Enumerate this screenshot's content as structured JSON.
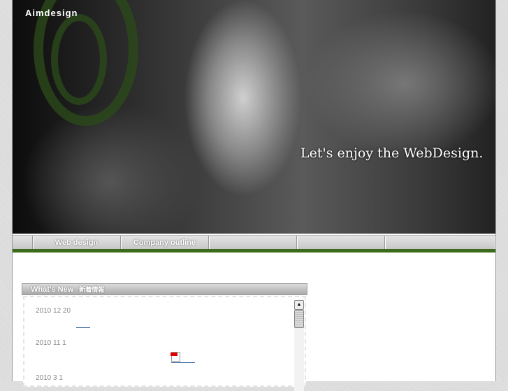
{
  "header": {
    "logo": "Aimdesign",
    "tagline": "Let's enjoy the WebDesign."
  },
  "nav": {
    "items": [
      {
        "label": ""
      },
      {
        "label": "Web design"
      },
      {
        "label": "Company outline"
      },
      {
        "label": ""
      },
      {
        "label": ""
      },
      {
        "label": ""
      }
    ]
  },
  "news": {
    "title": "What's New",
    "title_jp": "新着情報",
    "items": [
      {
        "date": "2010 12 20"
      },
      {
        "date": "2010 11 1"
      },
      {
        "date": "2010 3 1"
      }
    ]
  },
  "icons": {
    "pdf": "pdf-icon",
    "scroll_up": "▲"
  }
}
